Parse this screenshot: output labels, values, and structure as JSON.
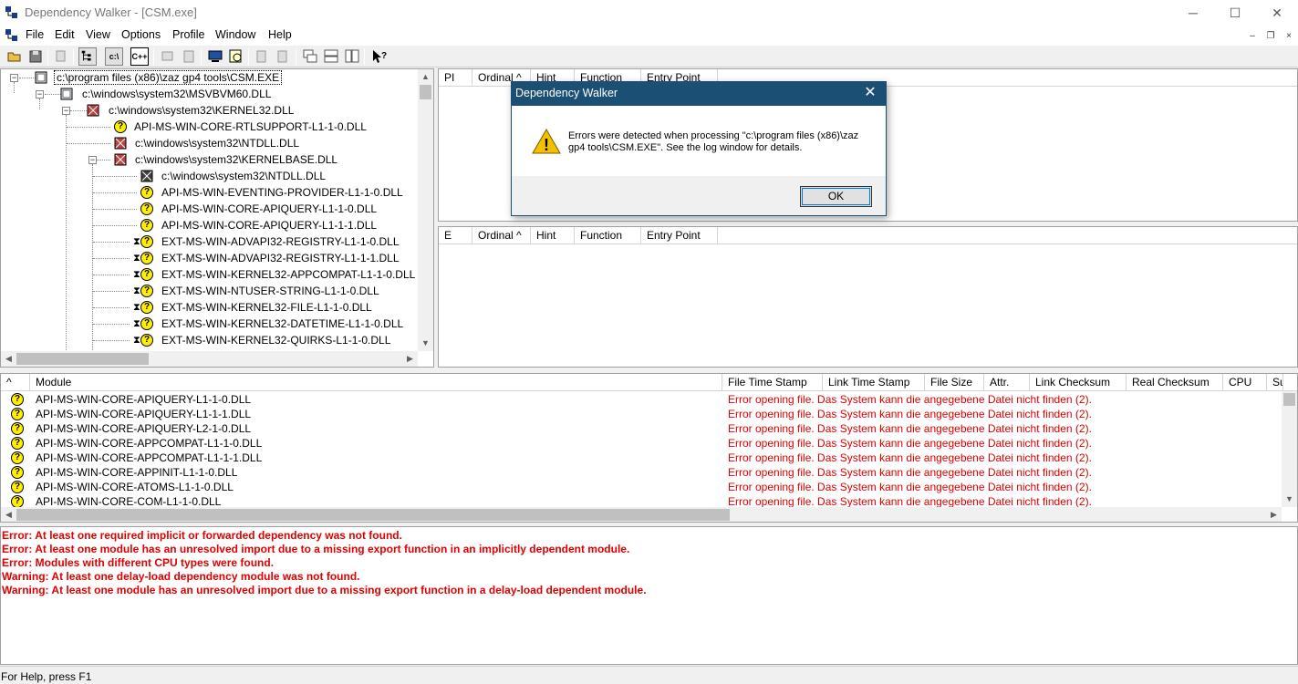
{
  "window": {
    "title": "Dependency Walker - [CSM.exe]",
    "minimize": "─",
    "maximize": "☐",
    "close": "✕"
  },
  "menu": [
    "File",
    "Edit",
    "View",
    "Options",
    "Profile",
    "Window",
    "Help"
  ],
  "mdi_controls": {
    "minimize": "–",
    "restore": "❐",
    "close": "×"
  },
  "toolbar": {
    "full_paths_label": "c:\\",
    "undecorate_label": "C++"
  },
  "tree": {
    "root": "c:\\program files (x86)\\zaz gp4 tools\\CSM.EXE",
    "items": [
      "c:\\windows\\system32\\MSVBVM60.DLL",
      "c:\\windows\\system32\\KERNEL32.DLL",
      "API-MS-WIN-CORE-RTLSUPPORT-L1-1-0.DLL",
      "c:\\windows\\system32\\NTDLL.DLL",
      "c:\\windows\\system32\\KERNELBASE.DLL",
      "c:\\windows\\system32\\NTDLL.DLL",
      "API-MS-WIN-EVENTING-PROVIDER-L1-1-0.DLL",
      "API-MS-WIN-CORE-APIQUERY-L1-1-0.DLL",
      "API-MS-WIN-CORE-APIQUERY-L1-1-1.DLL",
      "EXT-MS-WIN-ADVAPI32-REGISTRY-L1-1-0.DLL",
      "EXT-MS-WIN-ADVAPI32-REGISTRY-L1-1-1.DLL",
      "EXT-MS-WIN-KERNEL32-APPCOMPAT-L1-1-0.DLL",
      "EXT-MS-WIN-NTUSER-STRING-L1-1-0.DLL",
      "EXT-MS-WIN-KERNEL32-FILE-L1-1-0.DLL",
      "EXT-MS-WIN-KERNEL32-DATETIME-L1-1-0.DLL",
      "EXT-MS-WIN-KERNEL32-QUIRKS-L1-1-0.DLL"
    ]
  },
  "import_headers": [
    "PI",
    "Ordinal ^",
    "Hint",
    "Function",
    "Entry Point"
  ],
  "export_headers": [
    "E",
    "Ordinal ^",
    "Hint",
    "Function",
    "Entry Point"
  ],
  "module_list": {
    "headers": [
      "^",
      "Module",
      "File Time Stamp",
      "Link Time Stamp",
      "File Size",
      "Attr.",
      "Link Checksum",
      "Real Checksum",
      "CPU",
      "Su"
    ],
    "rows": [
      {
        "module": "API-MS-WIN-CORE-APIQUERY-L1-1-0.DLL",
        "error": "Error opening file. Das System kann die angegebene Datei nicht finden (2)."
      },
      {
        "module": "API-MS-WIN-CORE-APIQUERY-L1-1-1.DLL",
        "error": "Error opening file. Das System kann die angegebene Datei nicht finden (2)."
      },
      {
        "module": "API-MS-WIN-CORE-APIQUERY-L2-1-0.DLL",
        "error": "Error opening file. Das System kann die angegebene Datei nicht finden (2)."
      },
      {
        "module": "API-MS-WIN-CORE-APPCOMPAT-L1-1-0.DLL",
        "error": "Error opening file. Das System kann die angegebene Datei nicht finden (2)."
      },
      {
        "module": "API-MS-WIN-CORE-APPCOMPAT-L1-1-1.DLL",
        "error": "Error opening file. Das System kann die angegebene Datei nicht finden (2)."
      },
      {
        "module": "API-MS-WIN-CORE-APPINIT-L1-1-0.DLL",
        "error": "Error opening file. Das System kann die angegebene Datei nicht finden (2)."
      },
      {
        "module": "API-MS-WIN-CORE-ATOMS-L1-1-0.DLL",
        "error": "Error opening file. Das System kann die angegebene Datei nicht finden (2)."
      },
      {
        "module": "API-MS-WIN-CORE-COM-L1-1-0.DLL",
        "error": "Error opening file. Das System kann die angegebene Datei nicht finden (2)."
      }
    ]
  },
  "log": [
    "Error: At least one required implicit or forwarded dependency was not found.",
    "Error: At least one module has an unresolved import due to a missing export function in an implicitly dependent module.",
    "Error: Modules with different CPU types were found.",
    "Warning: At least one delay-load dependency module was not found.",
    "Warning: At least one module has an unresolved import due to a missing export function in a delay-load dependent module."
  ],
  "status": "For Help, press F1",
  "dialog": {
    "title": "Dependency Walker",
    "close": "✕",
    "message": "Errors were detected when processing \"c:\\program files (x86)\\zaz gp4 tools\\CSM.EXE\".  See the log window for details.",
    "ok_label": "OK"
  },
  "colors": {
    "error_text": "#e00000",
    "dialog_title_bar": "#1b4f73",
    "warning_icon": "#f2c200"
  },
  "icons": {
    "question": "?",
    "hourglass": "⧗",
    "warning_glyph": "!",
    "arrow_up": "▲",
    "arrow_down": "▼",
    "arrow_left": "◀",
    "arrow_right": "▶"
  }
}
